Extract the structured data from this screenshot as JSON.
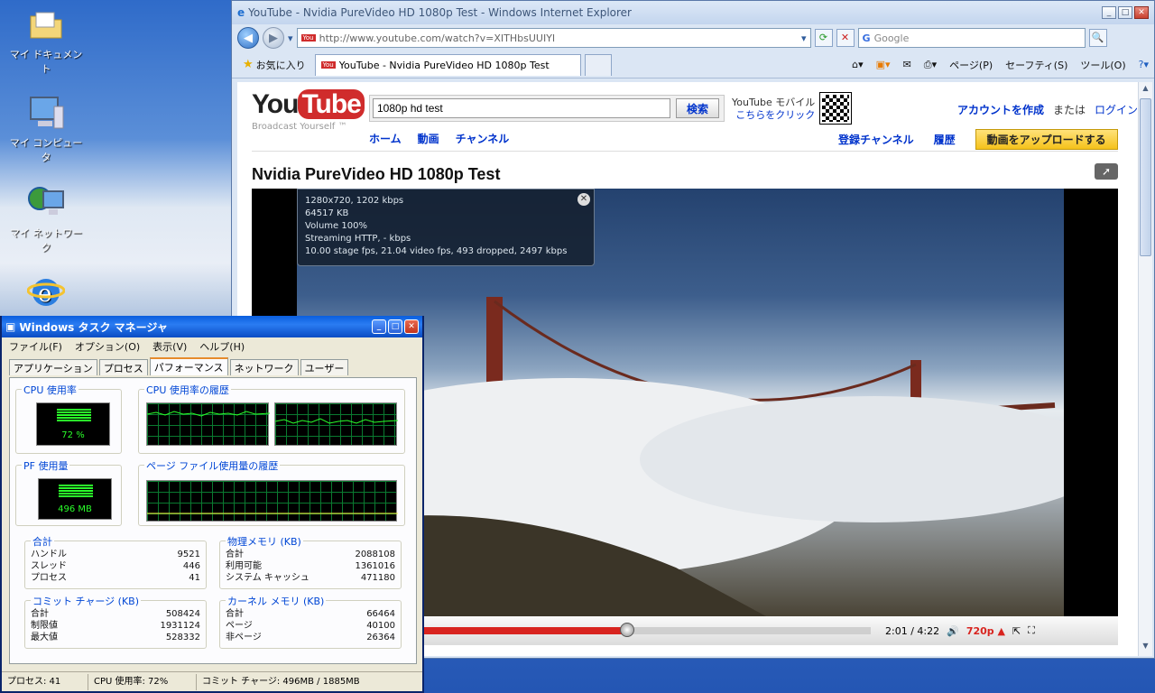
{
  "desktop": {
    "icons": [
      {
        "label": "マイ ドキュメント"
      },
      {
        "label": "マイ コンピュータ"
      },
      {
        "label": "マイ ネットワーク"
      }
    ]
  },
  "ie": {
    "title": "YouTube - Nvidia PureVideo HD 1080p Test - Windows Internet Explorer",
    "address": "http://www.youtube.com/watch?v=XITHbsUUIYI",
    "search_placeholder": "Google",
    "favorites": "お気に入り",
    "tab_title": "YouTube - Nvidia PureVideo HD 1080p Test",
    "tools": [
      "ページ(P)",
      "セーフティ(S)",
      "ツール(O)"
    ]
  },
  "youtube": {
    "logo_you": "You",
    "logo_tube": "Tube",
    "tagline": "Broadcast Yourself ™",
    "search_value": "1080p hd test",
    "search_button": "検索",
    "mobile_line1": "YouTube モバイル",
    "mobile_line2": "こちらをクリック",
    "nav": [
      "ホーム",
      "動画",
      "チャンネル"
    ],
    "create_account": "アカウントを作成",
    "or": "または",
    "login": "ログイン",
    "subscriptions": "登録チャンネル",
    "history": "履歴",
    "upload": "動画をアップロードする",
    "video_title": "Nvidia PureVideo HD 1080p Test",
    "stats": [
      "1280x720, 1202 kbps",
      "64517 KB",
      "Volume 100%",
      "Streaming HTTP, - kbps",
      "10.00 stage fps, 21.04 video fps, 493 dropped, 2497 kbps"
    ],
    "time": "2:01 / 4:22",
    "quality": "720p",
    "progress": 0.46
  },
  "taskmgr": {
    "title": "Windows タスク マネージャ",
    "menu": [
      "ファイル(F)",
      "オプション(O)",
      "表示(V)",
      "ヘルプ(H)"
    ],
    "tabs": [
      "アプリケーション",
      "プロセス",
      "パフォーマンス",
      "ネットワーク",
      "ユーザー"
    ],
    "cpu_label": "CPU 使用率",
    "cpu_value": "72 %",
    "cpu_hist_label": "CPU 使用率の履歴",
    "pf_label": "PF 使用量",
    "pf_value": "496 MB",
    "pf_hist_label": "ページ ファイル使用量の履歴",
    "totals": {
      "label": "合計",
      "rows": [
        [
          "ハンドル",
          "9521"
        ],
        [
          "スレッド",
          "446"
        ],
        [
          "プロセス",
          "41"
        ]
      ]
    },
    "physical": {
      "label": "物理メモリ (KB)",
      "rows": [
        [
          "合計",
          "2088108"
        ],
        [
          "利用可能",
          "1361016"
        ],
        [
          "システム キャッシュ",
          "471180"
        ]
      ]
    },
    "commit": {
      "label": "コミット チャージ (KB)",
      "rows": [
        [
          "合計",
          "508424"
        ],
        [
          "制限値",
          "1931124"
        ],
        [
          "最大値",
          "528332"
        ]
      ]
    },
    "kernel": {
      "label": "カーネル メモリ (KB)",
      "rows": [
        [
          "合計",
          "66464"
        ],
        [
          "ページ",
          "40100"
        ],
        [
          "非ページ",
          "26364"
        ]
      ]
    },
    "status": [
      "プロセス: 41",
      "CPU 使用率: 72%",
      "コミット チャージ: 496MB / 1885MB"
    ]
  }
}
